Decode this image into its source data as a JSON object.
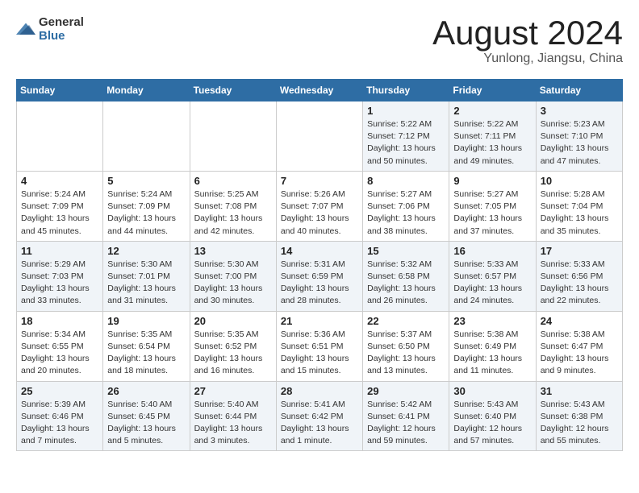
{
  "header": {
    "logo_general": "General",
    "logo_blue": "Blue",
    "month_title": "August 2024",
    "subtitle": "Yunlong, Jiangsu, China"
  },
  "calendar": {
    "days_of_week": [
      "Sunday",
      "Monday",
      "Tuesday",
      "Wednesday",
      "Thursday",
      "Friday",
      "Saturday"
    ],
    "weeks": [
      [
        {
          "day": "",
          "info": ""
        },
        {
          "day": "",
          "info": ""
        },
        {
          "day": "",
          "info": ""
        },
        {
          "day": "",
          "info": ""
        },
        {
          "day": "1",
          "info": "Sunrise: 5:22 AM\nSunset: 7:12 PM\nDaylight: 13 hours\nand 50 minutes."
        },
        {
          "day": "2",
          "info": "Sunrise: 5:22 AM\nSunset: 7:11 PM\nDaylight: 13 hours\nand 49 minutes."
        },
        {
          "day": "3",
          "info": "Sunrise: 5:23 AM\nSunset: 7:10 PM\nDaylight: 13 hours\nand 47 minutes."
        }
      ],
      [
        {
          "day": "4",
          "info": "Sunrise: 5:24 AM\nSunset: 7:09 PM\nDaylight: 13 hours\nand 45 minutes."
        },
        {
          "day": "5",
          "info": "Sunrise: 5:24 AM\nSunset: 7:09 PM\nDaylight: 13 hours\nand 44 minutes."
        },
        {
          "day": "6",
          "info": "Sunrise: 5:25 AM\nSunset: 7:08 PM\nDaylight: 13 hours\nand 42 minutes."
        },
        {
          "day": "7",
          "info": "Sunrise: 5:26 AM\nSunset: 7:07 PM\nDaylight: 13 hours\nand 40 minutes."
        },
        {
          "day": "8",
          "info": "Sunrise: 5:27 AM\nSunset: 7:06 PM\nDaylight: 13 hours\nand 38 minutes."
        },
        {
          "day": "9",
          "info": "Sunrise: 5:27 AM\nSunset: 7:05 PM\nDaylight: 13 hours\nand 37 minutes."
        },
        {
          "day": "10",
          "info": "Sunrise: 5:28 AM\nSunset: 7:04 PM\nDaylight: 13 hours\nand 35 minutes."
        }
      ],
      [
        {
          "day": "11",
          "info": "Sunrise: 5:29 AM\nSunset: 7:03 PM\nDaylight: 13 hours\nand 33 minutes."
        },
        {
          "day": "12",
          "info": "Sunrise: 5:30 AM\nSunset: 7:01 PM\nDaylight: 13 hours\nand 31 minutes."
        },
        {
          "day": "13",
          "info": "Sunrise: 5:30 AM\nSunset: 7:00 PM\nDaylight: 13 hours\nand 30 minutes."
        },
        {
          "day": "14",
          "info": "Sunrise: 5:31 AM\nSunset: 6:59 PM\nDaylight: 13 hours\nand 28 minutes."
        },
        {
          "day": "15",
          "info": "Sunrise: 5:32 AM\nSunset: 6:58 PM\nDaylight: 13 hours\nand 26 minutes."
        },
        {
          "day": "16",
          "info": "Sunrise: 5:33 AM\nSunset: 6:57 PM\nDaylight: 13 hours\nand 24 minutes."
        },
        {
          "day": "17",
          "info": "Sunrise: 5:33 AM\nSunset: 6:56 PM\nDaylight: 13 hours\nand 22 minutes."
        }
      ],
      [
        {
          "day": "18",
          "info": "Sunrise: 5:34 AM\nSunset: 6:55 PM\nDaylight: 13 hours\nand 20 minutes."
        },
        {
          "day": "19",
          "info": "Sunrise: 5:35 AM\nSunset: 6:54 PM\nDaylight: 13 hours\nand 18 minutes."
        },
        {
          "day": "20",
          "info": "Sunrise: 5:35 AM\nSunset: 6:52 PM\nDaylight: 13 hours\nand 16 minutes."
        },
        {
          "day": "21",
          "info": "Sunrise: 5:36 AM\nSunset: 6:51 PM\nDaylight: 13 hours\nand 15 minutes."
        },
        {
          "day": "22",
          "info": "Sunrise: 5:37 AM\nSunset: 6:50 PM\nDaylight: 13 hours\nand 13 minutes."
        },
        {
          "day": "23",
          "info": "Sunrise: 5:38 AM\nSunset: 6:49 PM\nDaylight: 13 hours\nand 11 minutes."
        },
        {
          "day": "24",
          "info": "Sunrise: 5:38 AM\nSunset: 6:47 PM\nDaylight: 13 hours\nand 9 minutes."
        }
      ],
      [
        {
          "day": "25",
          "info": "Sunrise: 5:39 AM\nSunset: 6:46 PM\nDaylight: 13 hours\nand 7 minutes."
        },
        {
          "day": "26",
          "info": "Sunrise: 5:40 AM\nSunset: 6:45 PM\nDaylight: 13 hours\nand 5 minutes."
        },
        {
          "day": "27",
          "info": "Sunrise: 5:40 AM\nSunset: 6:44 PM\nDaylight: 13 hours\nand 3 minutes."
        },
        {
          "day": "28",
          "info": "Sunrise: 5:41 AM\nSunset: 6:42 PM\nDaylight: 13 hours\nand 1 minute."
        },
        {
          "day": "29",
          "info": "Sunrise: 5:42 AM\nSunset: 6:41 PM\nDaylight: 12 hours\nand 59 minutes."
        },
        {
          "day": "30",
          "info": "Sunrise: 5:43 AM\nSunset: 6:40 PM\nDaylight: 12 hours\nand 57 minutes."
        },
        {
          "day": "31",
          "info": "Sunrise: 5:43 AM\nSunset: 6:38 PM\nDaylight: 12 hours\nand 55 minutes."
        }
      ]
    ]
  }
}
